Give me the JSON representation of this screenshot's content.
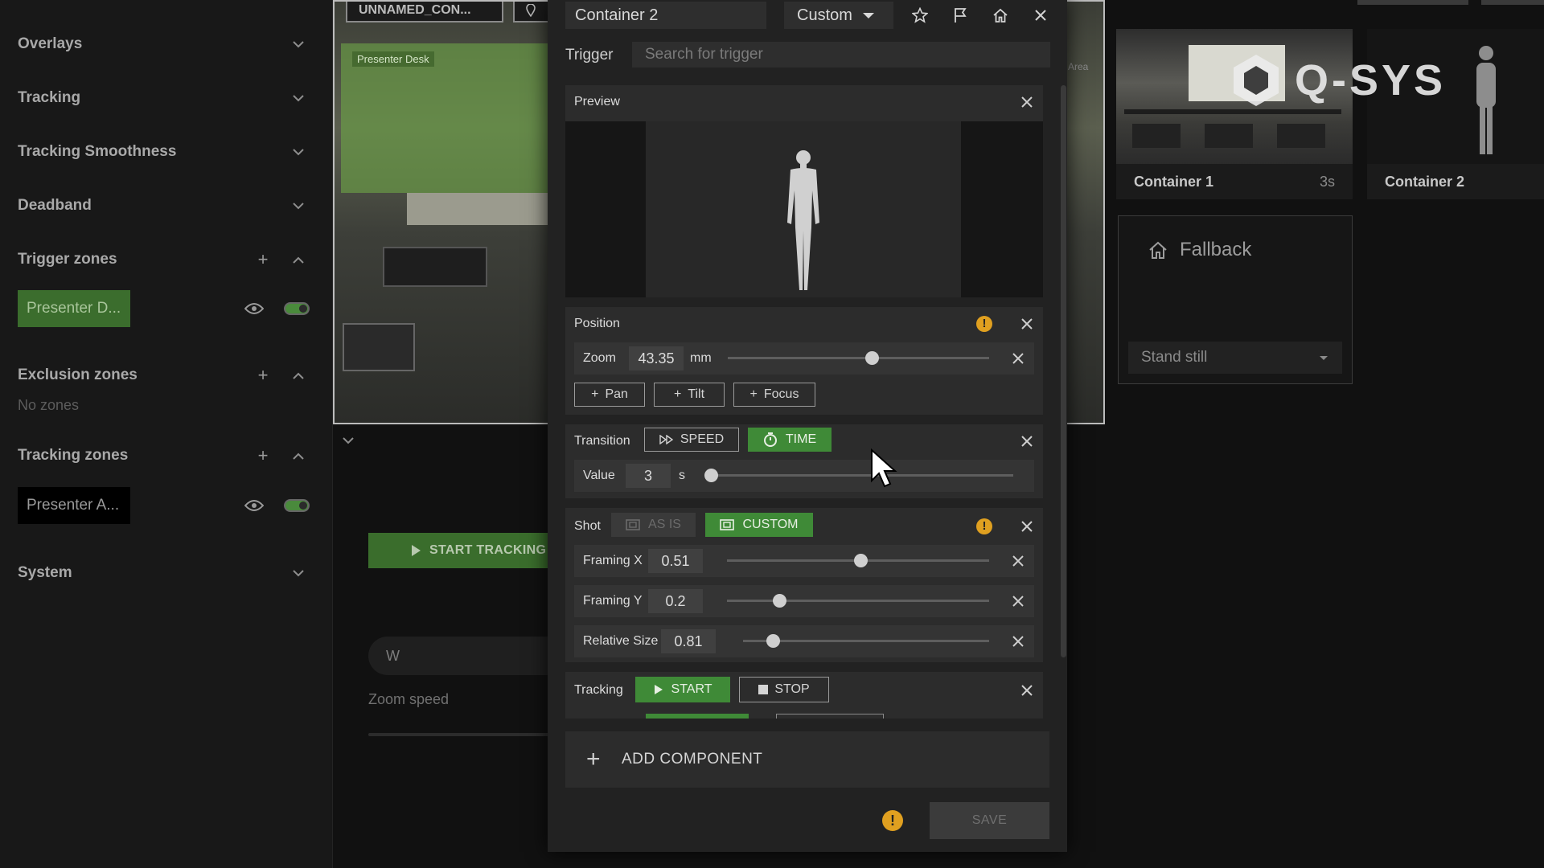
{
  "sidebar": {
    "sections": [
      {
        "title": "Overlays"
      },
      {
        "title": "Tracking"
      },
      {
        "title": "Tracking Smoothness"
      },
      {
        "title": "Deadband"
      },
      {
        "title": "Trigger zones"
      },
      {
        "title": "Exclusion zones"
      },
      {
        "title": "Tracking zones"
      },
      {
        "title": "System"
      }
    ],
    "trigger_zone": "Presenter D...",
    "exclusion_empty": "No zones",
    "tracking_zone": "Presenter A..."
  },
  "camera": {
    "tab1": "UNNAMED_CON...",
    "zone_label": "Presenter Desk",
    "area_label": "Area"
  },
  "main": {
    "start_tracking": "START TRACKING",
    "w_input": "W",
    "zoom_speed": "Zoom speed"
  },
  "right": {
    "logo": "Q-SYS",
    "container1": "Container 1",
    "container1_duration": "3s",
    "container2": "Container 2",
    "fallback_title": "Fallback",
    "fallback_select": "Stand still"
  },
  "modal": {
    "name": "Container 2",
    "mode": "Custom",
    "trigger_label": "Trigger",
    "trigger_placeholder": "Search for trigger",
    "preview": {
      "title": "Preview"
    },
    "position": {
      "title": "Position",
      "zoom_label": "Zoom",
      "zoom_value": "43.35",
      "zoom_unit": "mm",
      "zoom_level": 0.55,
      "add_buttons": [
        "Pan",
        "Tilt",
        "Focus"
      ]
    },
    "transition": {
      "title": "Transition",
      "speed_label": "SPEED",
      "time_label": "TIME",
      "value_label": "Value",
      "value": "3",
      "unit": "s",
      "level": 0.0
    },
    "shot": {
      "title": "Shot",
      "as_is_label": "AS IS",
      "custom_label": "CUSTOM",
      "framing_x_label": "Framing X",
      "framing_x": "0.51",
      "framing_y_label": "Framing Y",
      "framing_y": "0.2",
      "relative_size_label": "Relative Size",
      "relative_size": "0.81"
    },
    "tracking": {
      "title": "Tracking",
      "start_label": "START",
      "stop_label": "STOP"
    },
    "add_component": "ADD COMPONENT",
    "save": "SAVE"
  },
  "colors": {
    "accent_green": "#3f8a37",
    "warning": "#e0a020",
    "background": "#111111"
  }
}
